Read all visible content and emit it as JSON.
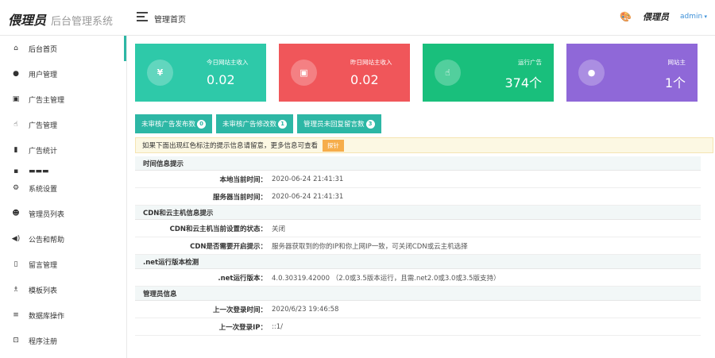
{
  "header": {
    "logo_mark": "偎理员",
    "logo_text": "后台管理系统",
    "page_title": "管理首页",
    "user_mark": "偎理员",
    "admin_name": "admin"
  },
  "sidebar": {
    "items": [
      {
        "label": "后台首页",
        "icon": "home-icon"
      },
      {
        "label": "用户管理",
        "icon": "user-icon"
      },
      {
        "label": "广告主管理",
        "icon": "id-card-icon"
      },
      {
        "label": "广告管理",
        "icon": "hand-icon"
      },
      {
        "label": "广告统计",
        "icon": "bar-chart-icon"
      },
      {
        "label": "系统设置",
        "icon": "gear-icon"
      },
      {
        "label": "管理员列表",
        "icon": "mask-icon"
      },
      {
        "label": "公告和帮助",
        "icon": "speaker-icon"
      },
      {
        "label": "留言管理",
        "icon": "clipboard-icon"
      },
      {
        "label": "模板列表",
        "icon": "shirt-icon"
      },
      {
        "label": "数据库操作",
        "icon": "database-icon"
      },
      {
        "label": "程序注册",
        "icon": "lock-icon"
      }
    ]
  },
  "stats": [
    {
      "label": "今日网站主收入",
      "value": "0.02",
      "icon": "yen-icon",
      "glyph": "¥",
      "color": "#2ec9a9"
    },
    {
      "label": "昨日网站主收入",
      "value": "0.02",
      "icon": "chess-icon",
      "glyph": "▣",
      "color": "#f0565a"
    },
    {
      "label": "运行广告",
      "value": "374个",
      "icon": "hand-icon",
      "glyph": "☝",
      "color": "#19bf7c"
    },
    {
      "label": "网站主",
      "value": "1个",
      "icon": "user-icon",
      "glyph": "●",
      "color": "#8f68d8"
    }
  ],
  "buttons": [
    {
      "label": "未审核广告发布数",
      "count": "0"
    },
    {
      "label": "未审核广告修改数",
      "count": "1"
    },
    {
      "label": "管理员未回复留言数",
      "count": "3"
    }
  ],
  "notice": {
    "text": "如果下面出现红色标注的提示信息请留意，更多信息可查看",
    "button": "探针"
  },
  "sections": [
    {
      "title": "时间信息提示",
      "rows": [
        {
          "key": "本地当前时间：",
          "value": "2020-06-24 21:41:31"
        },
        {
          "key": "服务器当前时间：",
          "value": "2020-06-24 21:41:31"
        }
      ]
    },
    {
      "title": "CDN和云主机信息提示",
      "rows": [
        {
          "key": "CDN和云主机当前设置的状态：",
          "value": "关闭"
        },
        {
          "key": "CDN是否需要开启提示：",
          "value": "服务器获取到的你的IP和你上网IP一致，可关闭CDN或云主机选择"
        }
      ]
    },
    {
      "title": ".net运行版本检测",
      "rows": [
        {
          "key": ".net运行版本：",
          "value": "4.0.30319.42000 （2.0或3.5版本运行，且需.net2.0或3.0或3.5版支持）"
        }
      ]
    },
    {
      "title": "管理员信息",
      "rows": [
        {
          "key": "上一次登录时间：",
          "value": "2020/6/23 19:46:58"
        },
        {
          "key": "上一次登录IP：",
          "value": "::1/"
        }
      ]
    }
  ]
}
